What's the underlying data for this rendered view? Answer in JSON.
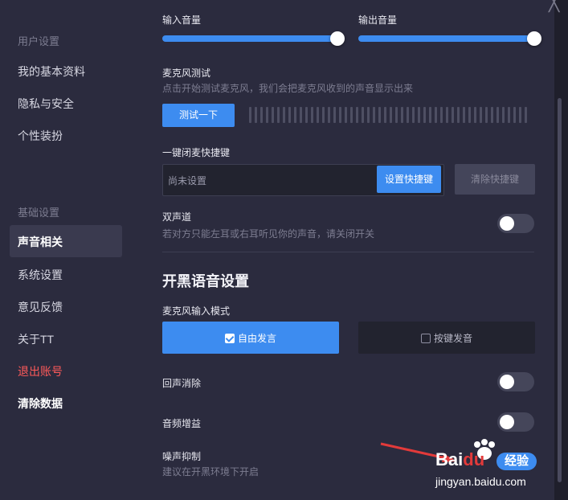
{
  "sidebar": {
    "section_user": "用户设置",
    "user_items": [
      "我的基本资料",
      "隐私与安全",
      "个性装扮"
    ],
    "section_basic": "基础设置",
    "active_item": "声音相关",
    "basic_items": [
      "系统设置",
      "意见反馈",
      "关于TT"
    ],
    "logout": "退出账号",
    "clear_data": "清除数据"
  },
  "volume": {
    "input_label": "输入音量",
    "output_label": "输出音量",
    "input_level": 1.0,
    "output_level": 1.0
  },
  "mic_test": {
    "title": "麦克风测试",
    "hint": "点击开始测试麦克风，我们会把麦克风收到的声音显示出来",
    "button": "测试一下"
  },
  "mute_hotkey": {
    "title": "一键闭麦快捷键",
    "placeholder": "尚未设置",
    "set_button": "设置快捷键",
    "clear_button": "清除快捷键"
  },
  "stereo": {
    "title": "双声道",
    "hint": "若对方只能左耳或右耳听见你的声音，请关闭开关",
    "on": false
  },
  "voice_section": {
    "heading": "开黑语音设置",
    "mic_mode_label": "麦克风输入模式",
    "mode_free": "自由发言",
    "mode_ptt": "按键发音",
    "echo_cancel": "回声消除",
    "audio_gain": "音频增益",
    "noise_suppress": "噪声抑制",
    "noise_hint": "建议在开黑环境下开启"
  },
  "watermark": {
    "brand": "Bai",
    "brand2": "du",
    "brand3": "经验",
    "url": "jingyan.baidu.com"
  },
  "colors": {
    "accent": "#3d8cf0",
    "danger": "#ff5a5a",
    "background": "#2b2b3e"
  }
}
